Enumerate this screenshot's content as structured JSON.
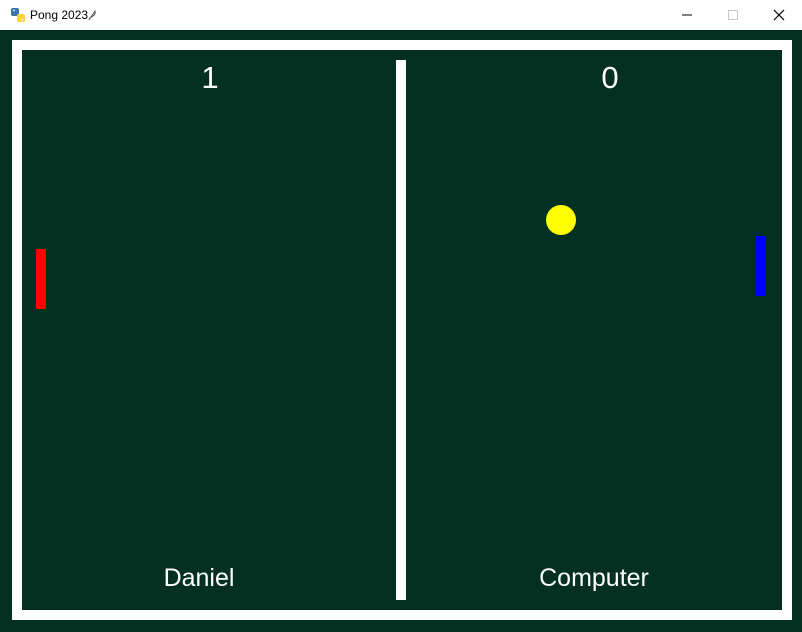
{
  "window": {
    "title": "Pong 2023",
    "icon": "python-icon"
  },
  "controls": {
    "minimize_icon": "minimize-icon",
    "maximize_icon": "maximize-icon",
    "close_icon": "close-icon"
  },
  "game": {
    "left_score": "1",
    "right_score": "0",
    "left_player": "Daniel",
    "right_player": "Computer",
    "colors": {
      "background": "#043022",
      "border": "#ffffff",
      "net": "#ffffff",
      "left_paddle": "#ff0000",
      "right_paddle": "#0000ff",
      "ball": "#ffff00"
    }
  }
}
